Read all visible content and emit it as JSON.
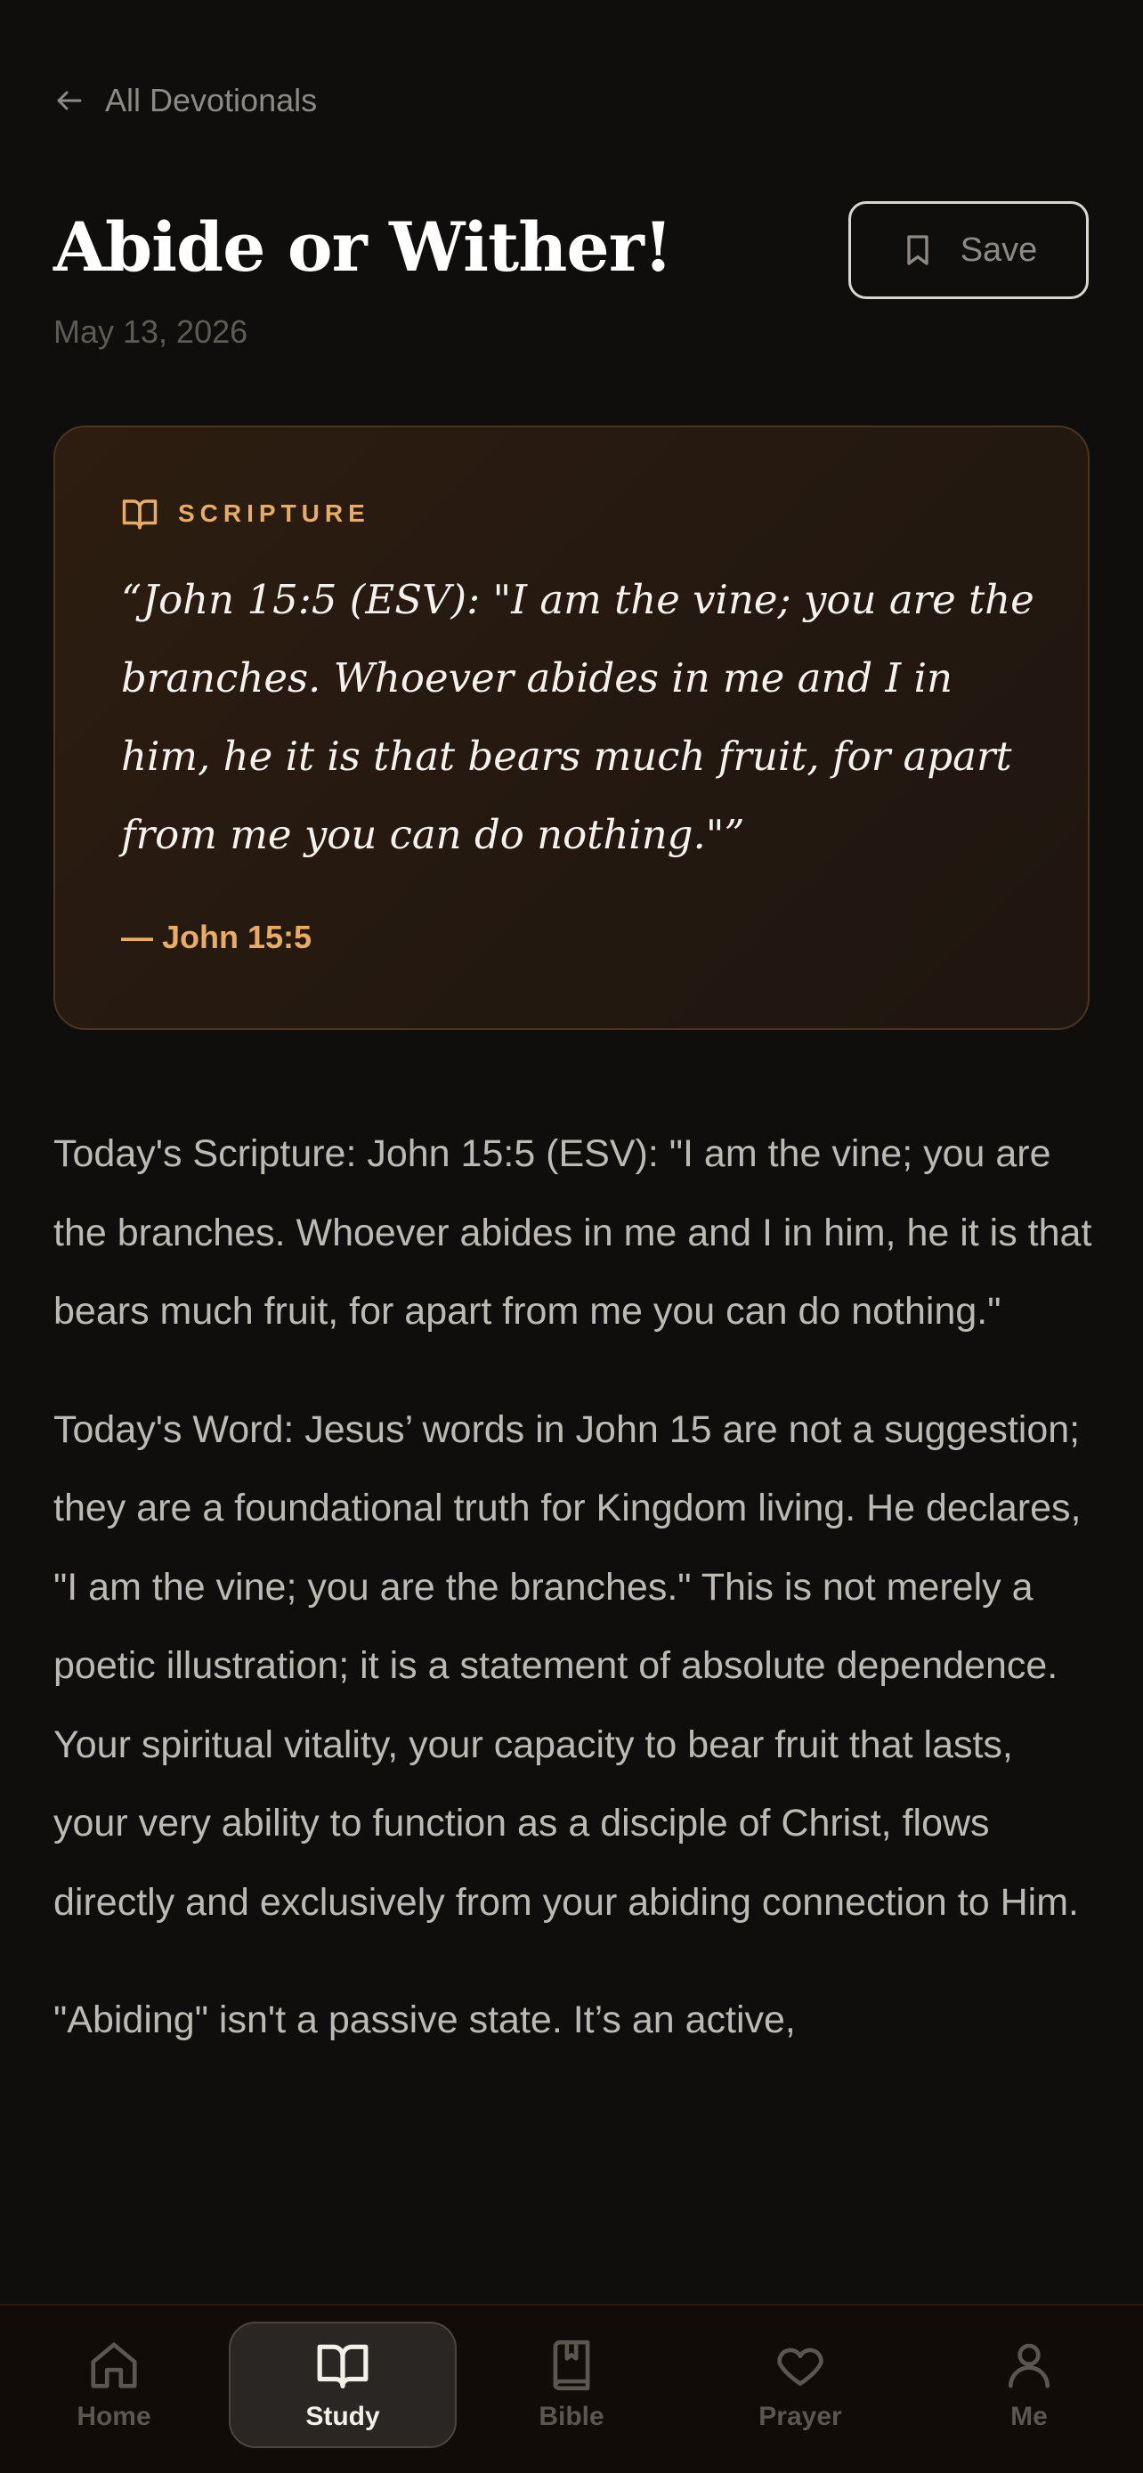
{
  "header": {
    "back_label": "All Devotionals",
    "title": "Abide or Wither!",
    "date": "May 13, 2026",
    "save_label": "Save"
  },
  "scripture": {
    "label": "SCRIPTURE",
    "quote": "“John 15:5 (ESV): \"I am the vine; you are the branches. Whoever abides in me and I in him, he it is that bears much fruit, for apart from me you can do nothing.\"”",
    "reference": "— John 15:5"
  },
  "body": {
    "paragraphs": [
      "Today's Scripture: John 15:5 (ESV): \"I am the vine; you are the branches. Whoever abides in me and I in him, he it is that bears much fruit, for apart from me you can do nothing.\"",
      "Today's Word: Jesus’ words in John 15 are not a suggestion; they are a foundational truth for Kingdom living. He declares, \"I am the vine; you are the branches.\" This is not merely a poetic illustration; it is a statement of absolute dependence. Your spiritual vitality, your capacity to bear fruit that lasts, your very ability to function as a disciple of Christ, flows directly and exclusively from your abiding connection to Him.",
      "\"Abiding\" isn't a passive state. It’s an active,"
    ]
  },
  "nav": {
    "items": [
      {
        "label": "Home",
        "icon": "home-icon"
      },
      {
        "label": "Study",
        "icon": "book-open-icon",
        "active": true
      },
      {
        "label": "Bible",
        "icon": "bible-icon"
      },
      {
        "label": "Prayer",
        "icon": "heart-icon"
      },
      {
        "label": "Me",
        "icon": "user-icon"
      }
    ]
  },
  "colors": {
    "background": "#0f0e0d",
    "accent": "#e8ad65",
    "card_background": "#2a1c11",
    "card_border": "#4a3520",
    "nav_background": "#120c09"
  }
}
